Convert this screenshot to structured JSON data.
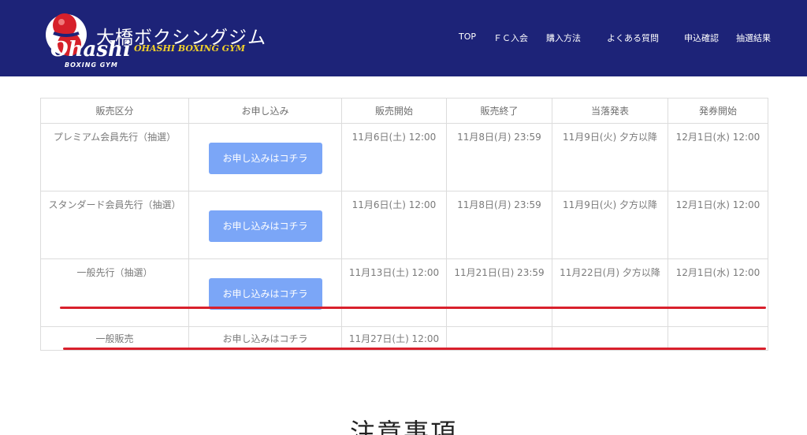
{
  "header": {
    "logo_jp": "大橋ボクシングジム",
    "logo_en": "OHASHI BOXING GYM",
    "logo_script": "Ohashi",
    "logo_sub": "BOXING GYM"
  },
  "nav": [
    "TOP",
    "ＦＣ入会",
    "購入方法",
    "よくある質問",
    "申込確認",
    "抽選結果"
  ],
  "table": {
    "headers": [
      "販売区分",
      "お申し込み",
      "販売開始",
      "販売終了",
      "当落発表",
      "発券開始"
    ],
    "rows": [
      {
        "category": "プレミアム会員先行（抽選）",
        "apply": "お申し込みはコチラ",
        "start": "11月6日(土) 12:00",
        "end": "11月8日(月) 23:59",
        "announce": "11月9日(火) 夕方以降",
        "ticket": "12月1日(水) 12:00"
      },
      {
        "category": "スタンダード会員先行（抽選）",
        "apply": "お申し込みはコチラ",
        "start": "11月6日(土) 12:00",
        "end": "11月8日(月) 23:59",
        "announce": "11月9日(火) 夕方以降",
        "ticket": "12月1日(水) 12:00"
      },
      {
        "category": "一般先行（抽選）",
        "apply": "お申し込みはコチラ",
        "start": "11月13日(土) 12:00",
        "end": "11月21日(日) 23:59",
        "announce": "11月22日(月) 夕方以降",
        "ticket": "12月1日(水) 12:00"
      },
      {
        "category": "一般販売",
        "apply": "お申し込みはコチラ",
        "start": "11月27日(土) 12:00",
        "end": "",
        "announce": "",
        "ticket": ""
      }
    ]
  },
  "section_title": "注意事項",
  "colors": {
    "header_bg": "#1d2378",
    "button_bg": "#7ba6f7",
    "highlight_line": "#d9202c",
    "logo_gold": "#f2d22a"
  }
}
